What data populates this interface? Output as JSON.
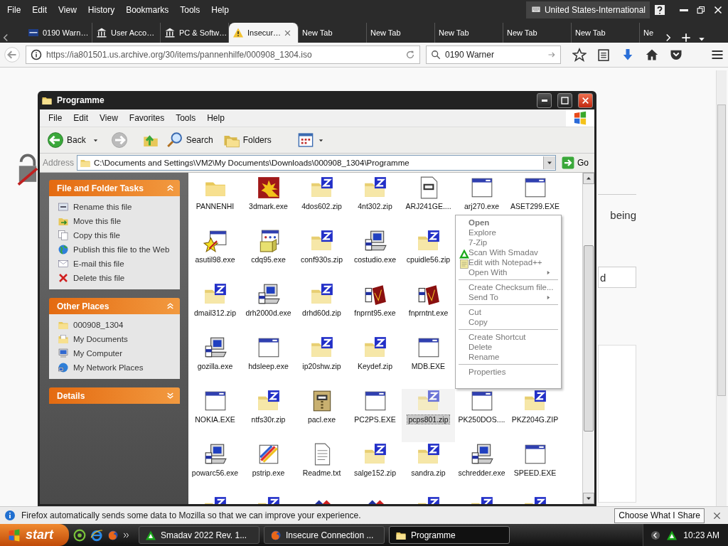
{
  "browser": {
    "menu": [
      "File",
      "Edit",
      "View",
      "History",
      "Bookmarks",
      "Tools",
      "Help"
    ],
    "keyboard_layout": "United States-International",
    "tabs": [
      {
        "title": "0190 Warn…",
        "kind": "badge",
        "selected": false
      },
      {
        "title": "User Acco…",
        "kind": "bank",
        "selected": false
      },
      {
        "title": "PC & Softw…",
        "kind": "bank",
        "selected": false
      },
      {
        "title": "Insecur…",
        "kind": "warning",
        "selected": true
      },
      {
        "title": "New Tab",
        "kind": "blank",
        "selected": false
      },
      {
        "title": "New Tab",
        "kind": "blank",
        "selected": false
      },
      {
        "title": "New Tab",
        "kind": "blank",
        "selected": false
      },
      {
        "title": "New Tab",
        "kind": "blank",
        "selected": false
      },
      {
        "title": "New Tab",
        "kind": "blank",
        "selected": false
      },
      {
        "title": "Ne",
        "kind": "blank",
        "selected": false
      }
    ],
    "url": "https://ia801501.us.archive.org/30/items/pannenhilfe/000908_1304.iso",
    "search": {
      "value": "0190 Warner"
    }
  },
  "page": {
    "text_fragment": "being",
    "button_fragment": "d"
  },
  "explorer": {
    "title": "Programme",
    "menu": [
      "File",
      "Edit",
      "View",
      "Favorites",
      "Tools",
      "Help"
    ],
    "toolbar": {
      "back": "Back",
      "search": "Search",
      "folders": "Folders"
    },
    "address_label": "Address",
    "address": "C:\\Documents and Settings\\VM2\\My Documents\\Downloads\\000908_1304\\Programme",
    "go": "Go",
    "panels": [
      {
        "title": "File and Folder Tasks",
        "expanded": true,
        "items": [
          {
            "label": "Rename this file",
            "kind": "rename"
          },
          {
            "label": "Move this file",
            "kind": "move"
          },
          {
            "label": "Copy this file",
            "kind": "copy"
          },
          {
            "label": "Publish this file to the Web",
            "kind": "globe"
          },
          {
            "label": "E-mail this file",
            "kind": "mail"
          },
          {
            "label": "Delete this file",
            "kind": "delete"
          }
        ]
      },
      {
        "title": "Other Places",
        "expanded": true,
        "items": [
          {
            "label": "000908_1304",
            "kind": "folder"
          },
          {
            "label": "My Documents",
            "kind": "documents"
          },
          {
            "label": "My Computer",
            "kind": "computer"
          },
          {
            "label": "My Network Places",
            "kind": "network"
          }
        ]
      },
      {
        "title": "Details",
        "expanded": false
      }
    ],
    "files": [
      {
        "label": "PANNENHI",
        "kind": "folder",
        "selected": false
      },
      {
        "label": "3dmark.exe",
        "kind": "burst",
        "selected": false
      },
      {
        "label": "4dos602.zip",
        "kind": "zip",
        "selected": false
      },
      {
        "label": "4nt302.zip",
        "kind": "zip",
        "selected": false
      },
      {
        "label": "ARJ241GE....",
        "kind": "settings-file",
        "selected": false
      },
      {
        "label": "arj270.exe",
        "kind": "window",
        "selected": false
      },
      {
        "label": "ASET299.EXE",
        "kind": "window",
        "selected": false
      },
      {
        "label": "asutil98.exe",
        "kind": "star-window",
        "selected": false
      },
      {
        "label": "cdq95.exe",
        "kind": "box-window",
        "selected": false
      },
      {
        "label": "conf930s.zip",
        "kind": "zip",
        "selected": false
      },
      {
        "label": "costudio.exe",
        "kind": "setup",
        "selected": false
      },
      {
        "label": "cpuidle56.zip",
        "kind": "zip",
        "selected": false
      },
      {
        "label": "dmail312.zip",
        "kind": "zip",
        "selected": false
      },
      {
        "label": "drh2000d.exe",
        "kind": "setup",
        "selected": false
      },
      {
        "label": "drhd60d.zip",
        "kind": "zip",
        "selected": false
      },
      {
        "label": "fnprnt95.exe",
        "kind": "cloth",
        "selected": false
      },
      {
        "label": "fnprntnt.exe",
        "kind": "cloth",
        "selected": false
      },
      {
        "label": "gozilla.exe",
        "kind": "setup",
        "selected": false
      },
      {
        "label": "hdsleep.exe",
        "kind": "window",
        "selected": false
      },
      {
        "label": "ip20shw.zip",
        "kind": "zip",
        "selected": false
      },
      {
        "label": "Keydef.zip",
        "kind": "zip",
        "selected": false
      },
      {
        "label": "MDB.EXE",
        "kind": "window",
        "selected": false
      },
      {
        "label": "NOKIA.EXE",
        "kind": "window",
        "selected": false
      },
      {
        "label": "ntfs30r.zip",
        "kind": "zip",
        "selected": false
      },
      {
        "label": "pacl.exe",
        "kind": "archive",
        "selected": false
      },
      {
        "label": "PC2PS.EXE",
        "kind": "window",
        "selected": false
      },
      {
        "label": "pcps801.zip",
        "kind": "zip",
        "selected": true
      },
      {
        "label": "PK250DOS....",
        "kind": "window",
        "selected": false
      },
      {
        "label": "PKZ204G.ZIP",
        "kind": "zip",
        "selected": false
      },
      {
        "label": "powarc56.exe",
        "kind": "setup",
        "selected": false
      },
      {
        "label": "pstrip.exe",
        "kind": "stripes",
        "selected": false
      },
      {
        "label": "Readme.txt",
        "kind": "text",
        "selected": false
      },
      {
        "label": "salge152.zip",
        "kind": "zip",
        "selected": false
      },
      {
        "label": "sandra.zip",
        "kind": "zip",
        "selected": false
      },
      {
        "label": "schredder.exe",
        "kind": "setup",
        "selected": false
      },
      {
        "label": "SPEED.EXE",
        "kind": "window",
        "selected": false
      }
    ],
    "cut_off_row": [
      {
        "kind": "zip"
      },
      {
        "kind": "zip"
      },
      {
        "kind": "arrows"
      },
      {
        "kind": "arrows"
      },
      {
        "kind": "zip"
      },
      {
        "kind": "zip"
      },
      {
        "kind": "zip"
      }
    ],
    "context_menu": [
      {
        "kind": "item",
        "label": "Open",
        "default": true
      },
      {
        "kind": "item",
        "label": "Explore",
        "default": false
      },
      {
        "kind": "item",
        "label": "7-Zip",
        "default": false
      },
      {
        "kind": "scan",
        "label": "Scan With Smadav",
        "default": false
      },
      {
        "kind": "notepad",
        "label": "Edit with Notepad++",
        "default": false
      },
      {
        "kind": "submenu",
        "label": "Open With",
        "default": false
      },
      {
        "kind": "separator"
      },
      {
        "kind": "item",
        "label": "Create Checksum file...",
        "default": false
      },
      {
        "kind": "submenu",
        "label": "Send To",
        "default": false
      },
      {
        "kind": "separator"
      },
      {
        "kind": "item",
        "label": "Cut",
        "default": false
      },
      {
        "kind": "item",
        "label": "Copy",
        "default": false
      },
      {
        "kind": "separator"
      },
      {
        "kind": "item",
        "label": "Create Shortcut",
        "default": false
      },
      {
        "kind": "item",
        "label": "Delete",
        "default": false
      },
      {
        "kind": "item",
        "label": "Rename",
        "default": false
      },
      {
        "kind": "separator"
      },
      {
        "kind": "item",
        "label": "Properties",
        "default": false
      }
    ]
  },
  "notification": {
    "text": "Firefox automatically sends some data to Mozilla so that we can improve your experience.",
    "button": "Choose What I Share"
  },
  "taskbar": {
    "start": "start",
    "tasks": [
      {
        "label": "Smadav 2022 Rev. 1...",
        "kind": "scanner",
        "selected": false
      },
      {
        "label": "Insecure Connection ...",
        "kind": "firefox",
        "selected": false
      },
      {
        "label": "Programme",
        "kind": "folder",
        "selected": true
      }
    ],
    "clock": "10:23 AM"
  }
}
